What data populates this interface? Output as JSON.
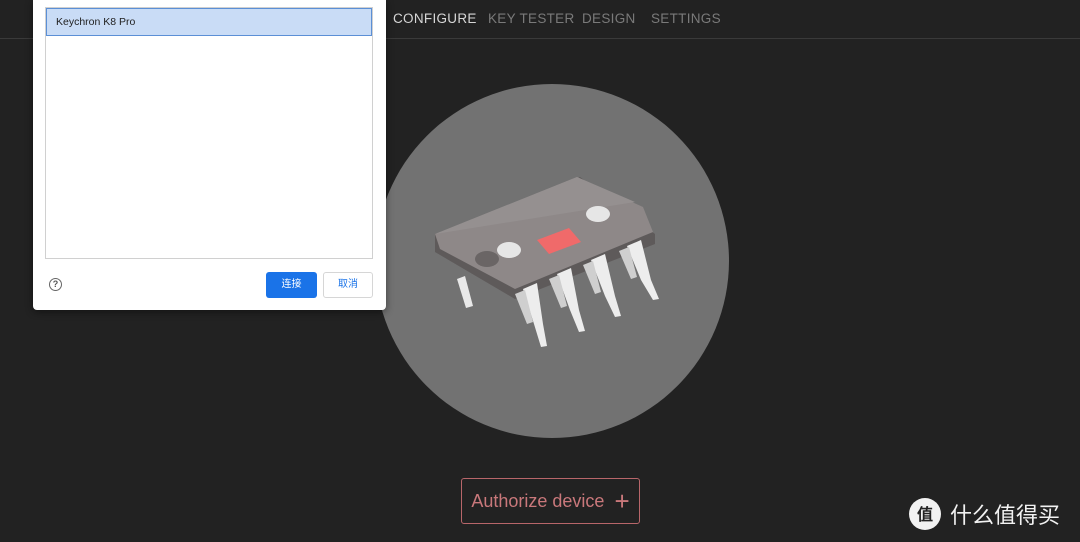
{
  "nav": {
    "items": [
      {
        "label": "CONFIGURE",
        "active": true
      },
      {
        "label": "KEY TESTER",
        "active": false
      },
      {
        "label": "DESIGN",
        "active": false
      },
      {
        "label": "SETTINGS",
        "active": false
      }
    ]
  },
  "illustration": {
    "icon": "microchip-icon",
    "circle_color": "#727272",
    "led_color": "#f06a6a"
  },
  "authorize": {
    "label": "Authorize device",
    "icon": "plus-icon",
    "accent": "#c9787b"
  },
  "dialog": {
    "devices": [
      "Keychron K8 Pro"
    ],
    "help_icon": "?",
    "connect_label": "连接",
    "cancel_label": "取消"
  },
  "watermark": {
    "text": "什么值得买",
    "logo": "值"
  }
}
